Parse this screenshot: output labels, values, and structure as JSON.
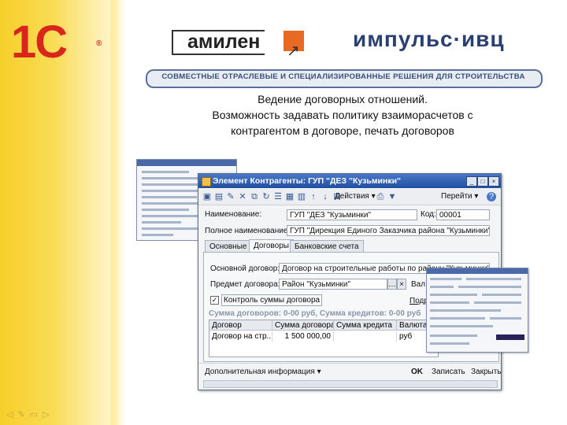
{
  "slide": {
    "logo_1c": "1С",
    "logo_1c_reg": "®",
    "logo_amilen": "амилен",
    "logo_impuls": "импульс·ивц",
    "banner": "СОВМЕСТНЫЕ ОТРАСЛЕВЫЕ И СПЕЦИАЛИЗИРОВАННЫЕ РЕШЕНИЯ ДЛЯ СТРОИТЕЛЬСТВА",
    "heading_lines": [
      "Ведение договорных отношений.",
      "Возможность задавать политику взаиморасчетов с",
      "контрагентом в договоре, печать договоров"
    ]
  },
  "window": {
    "title": "Элемент Контрагенты: ГУП \"ДЕЗ \"Кузьминки\"",
    "toolbar": {
      "actions_label": "Действия",
      "goto_label": "Перейти"
    },
    "fields": {
      "name_label": "Наименование:",
      "name_value": "ГУП \"ДЕЗ \"Кузьминки\"",
      "code_label": "Код:",
      "code_value": "00001",
      "fullname_label": "Полное наименование:",
      "fullname_value": "ГУП \"Дирекция Единого Заказчика района \"Кузьминки\""
    },
    "tabs": [
      "Основные",
      "Договоры",
      "Банковские счета"
    ],
    "contracts": {
      "main_contract_label": "Основной договор:",
      "main_contract_value": "Договор на строительные работы по району \"Кузьминки\"",
      "subject_label": "Предмет договора:",
      "subject_value": "Район \"Кузьминки\"",
      "currency_cut": "Вал",
      "control_label": "Контроль суммы договора",
      "detail_link": "Подробная и",
      "sum_line": "Сумма договоров: 0-00 руб, Сумма кредитов: 0-00 руб"
    },
    "grid": {
      "headers": [
        "Договор",
        "Сумма договора",
        "Сумма кредита",
        "Валюта"
      ],
      "rows": [
        [
          "Договор на стр...",
          "1 500 000,00",
          "",
          "руб"
        ]
      ]
    },
    "bottom": {
      "more_info": "Дополнительная информация",
      "ok": "OK",
      "save": "Записать",
      "close": "Закрыть"
    }
  }
}
